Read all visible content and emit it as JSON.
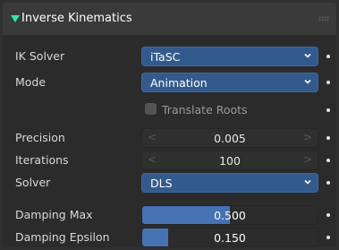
{
  "panel": {
    "title": "Inverse Kinematics"
  },
  "ik_solver": {
    "label": "IK Solver",
    "value": "iTaSC"
  },
  "mode": {
    "label": "Mode",
    "value": "Animation"
  },
  "translate_roots": {
    "label": "Translate Roots",
    "checked": false
  },
  "precision": {
    "label": "Precision",
    "value": "0.005"
  },
  "iterations": {
    "label": "Iterations",
    "value": "100"
  },
  "solver": {
    "label": "Solver",
    "value": "DLS"
  },
  "damping_max": {
    "label": "Damping Max",
    "value": "0.500",
    "fraction": 0.5
  },
  "damping_epsilon": {
    "label": "Damping Epsilon",
    "value": "0.150",
    "fraction": 0.15
  },
  "colors": {
    "accent": "#4572b3",
    "dropdown": "#335a8c",
    "header_triangle": "#2ee8a5"
  }
}
